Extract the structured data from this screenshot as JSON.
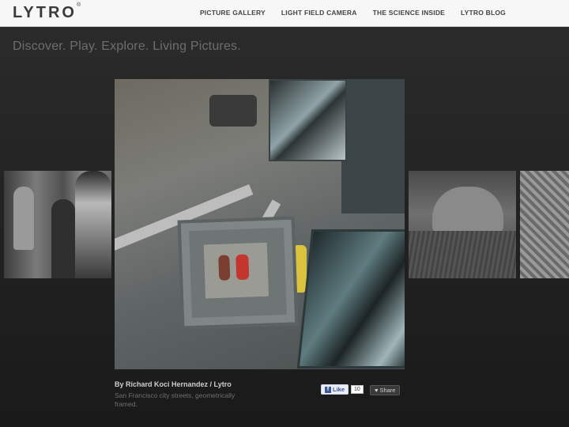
{
  "header": {
    "logo": "LYTRO",
    "logo_mark": "®",
    "nav": [
      "PICTURE GALLERY",
      "LIGHT FIELD CAMERA",
      "THE SCIENCE INSIDE",
      "LYTRO BLOG"
    ]
  },
  "tagline": "Discover. Play. Explore. Living Pictures.",
  "caption": {
    "author": "By Richard Koci Hernandez / Lytro",
    "description": "San Francisco city streets, geometrically framed."
  },
  "social": {
    "like_icon": "f",
    "like_label": "Like",
    "like_count": "10",
    "share_icon": "♥",
    "share_label": "Share"
  },
  "colors": {
    "header_bg": "#f7f7f7",
    "page_bg": "#1f1f1f",
    "facebook_blue": "#3b5998"
  }
}
